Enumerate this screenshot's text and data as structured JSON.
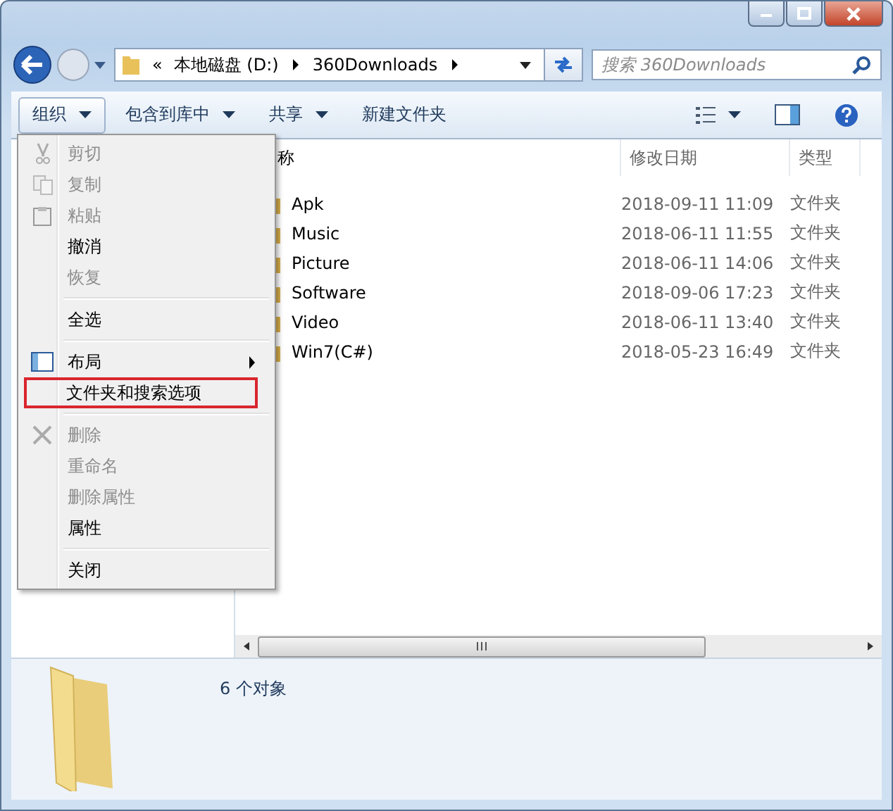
{
  "address": {
    "overflow": "«",
    "crumbs": [
      "本地磁盘 (D:)",
      "360Downloads"
    ]
  },
  "search": {
    "placeholder": "搜索 360Downloads"
  },
  "toolbar": [
    {
      "label": "组织",
      "dropdown": true,
      "selected": true
    },
    {
      "label": "包含到库中",
      "dropdown": true,
      "selected": false
    },
    {
      "label": "共享",
      "dropdown": true,
      "selected": false
    },
    {
      "label": "新建文件夹",
      "dropdown": false,
      "selected": false
    }
  ],
  "columns": [
    "称",
    "修改日期",
    "类型"
  ],
  "files": [
    {
      "name": "Apk",
      "date": "2018-09-11 11:09",
      "type": "文件夹"
    },
    {
      "name": "Music",
      "date": "2018-06-11 11:55",
      "type": "文件夹"
    },
    {
      "name": "Picture",
      "date": "2018-06-11 14:06",
      "type": "文件夹"
    },
    {
      "name": "Software",
      "date": "2018-09-06 17:23",
      "type": "文件夹"
    },
    {
      "name": "Video",
      "date": "2018-06-11 13:40",
      "type": "文件夹"
    },
    {
      "name": "Win7(C#)",
      "date": "2018-05-23 16:49",
      "type": "文件夹"
    }
  ],
  "menu": [
    {
      "kind": "cut",
      "label": "剪切",
      "disabled": true,
      "highlighted": false
    },
    {
      "kind": "copy",
      "label": "复制",
      "disabled": true,
      "highlighted": false
    },
    {
      "kind": "paste",
      "label": "粘贴",
      "disabled": true,
      "highlighted": false
    },
    {
      "kind": "plain",
      "label": "撤消",
      "disabled": false,
      "highlighted": false
    },
    {
      "kind": "plain",
      "label": "恢复",
      "disabled": true,
      "highlighted": false
    },
    {
      "kind": "separator"
    },
    {
      "kind": "plain",
      "label": "全选",
      "disabled": false,
      "highlighted": false
    },
    {
      "kind": "separator"
    },
    {
      "kind": "layout",
      "label": "布局",
      "disabled": false,
      "highlighted": false,
      "submenu": true
    },
    {
      "kind": "plain",
      "label": "文件夹和搜索选项",
      "disabled": false,
      "highlighted": true
    },
    {
      "kind": "separator"
    },
    {
      "kind": "delete",
      "label": "删除",
      "disabled": true,
      "highlighted": false
    },
    {
      "kind": "plain",
      "label": "重命名",
      "disabled": true,
      "highlighted": false
    },
    {
      "kind": "plain",
      "label": "删除属性",
      "disabled": true,
      "highlighted": false
    },
    {
      "kind": "plain",
      "label": "属性",
      "disabled": false,
      "highlighted": false
    },
    {
      "kind": "separator"
    },
    {
      "kind": "plain",
      "label": "关闭",
      "disabled": false,
      "highlighted": false
    }
  ],
  "details": {
    "count": "6 个对象"
  }
}
